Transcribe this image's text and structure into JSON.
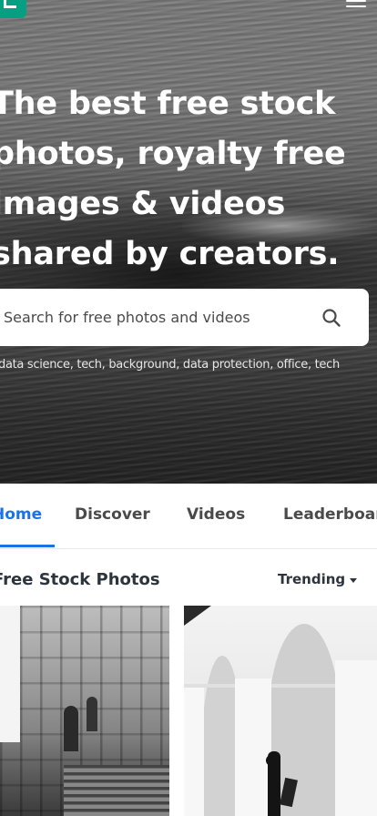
{
  "header": {
    "logo_icon": "pexels-logo-icon",
    "menu_icon": "hamburger-menu-icon",
    "brand_color": "#05a081"
  },
  "hero": {
    "headline_lines": [
      "The best free stock",
      "photos, royalty free",
      "images & videos",
      "shared by creators."
    ],
    "search": {
      "placeholder": "Search for free photos and videos",
      "icon": "search-icon"
    },
    "suggested_tags": "data science, tech, background, data protection, office, tech"
  },
  "tabs": {
    "items": [
      {
        "label": "Home",
        "active": true
      },
      {
        "label": "Discover",
        "active": false
      },
      {
        "label": "Videos",
        "active": false
      },
      {
        "label": "Leaderboard",
        "active": false
      }
    ],
    "active_color": "#1a73e8"
  },
  "feed": {
    "title": "Free Stock Photos",
    "sort_label": "Trending",
    "sort_icon": "caret-down-icon"
  }
}
